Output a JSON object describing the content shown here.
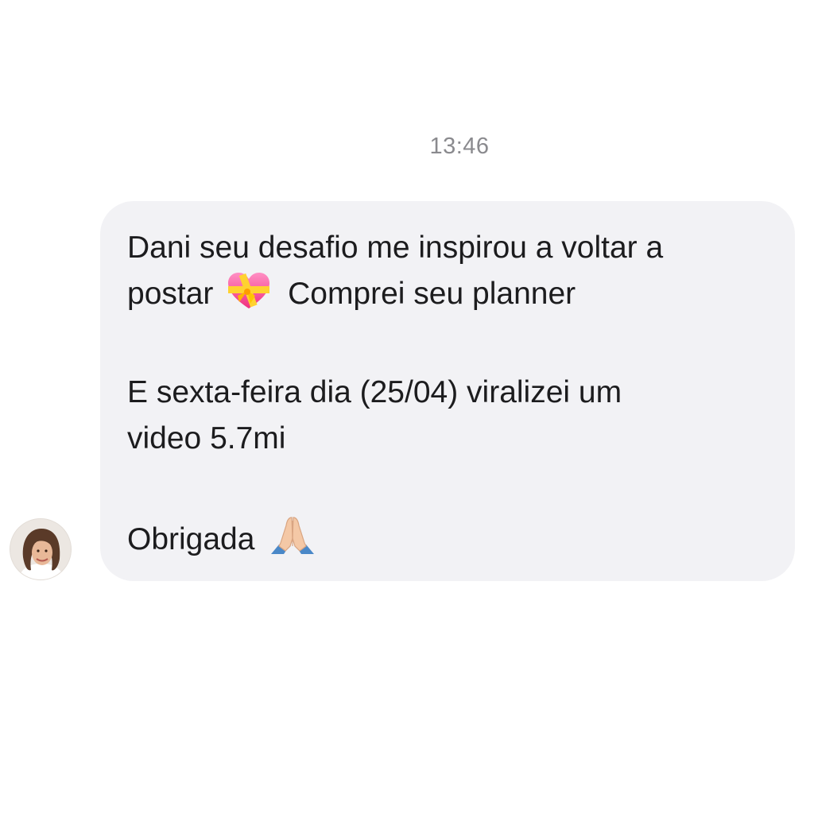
{
  "conversation": {
    "timestamp": "13:46",
    "message": {
      "line1": "Dani seu desafio me inspirou a voltar a",
      "line2_start": "postar",
      "line2_end": "Comprei seu planner",
      "line3": "E sexta-feira dia (25/04) viralizei um",
      "line4": "video 5.7mi",
      "line5": "Obrigada",
      "emoji1": "heart-with-ribbon-icon",
      "emoji2": "folded-hands-icon"
    },
    "sender": {
      "avatar": "avatar-photo"
    }
  },
  "colors": {
    "bubble": "#f2f2f5",
    "text": "#1c1c1e",
    "timestamp": "#8a8a8e",
    "background": "#ffffff"
  }
}
